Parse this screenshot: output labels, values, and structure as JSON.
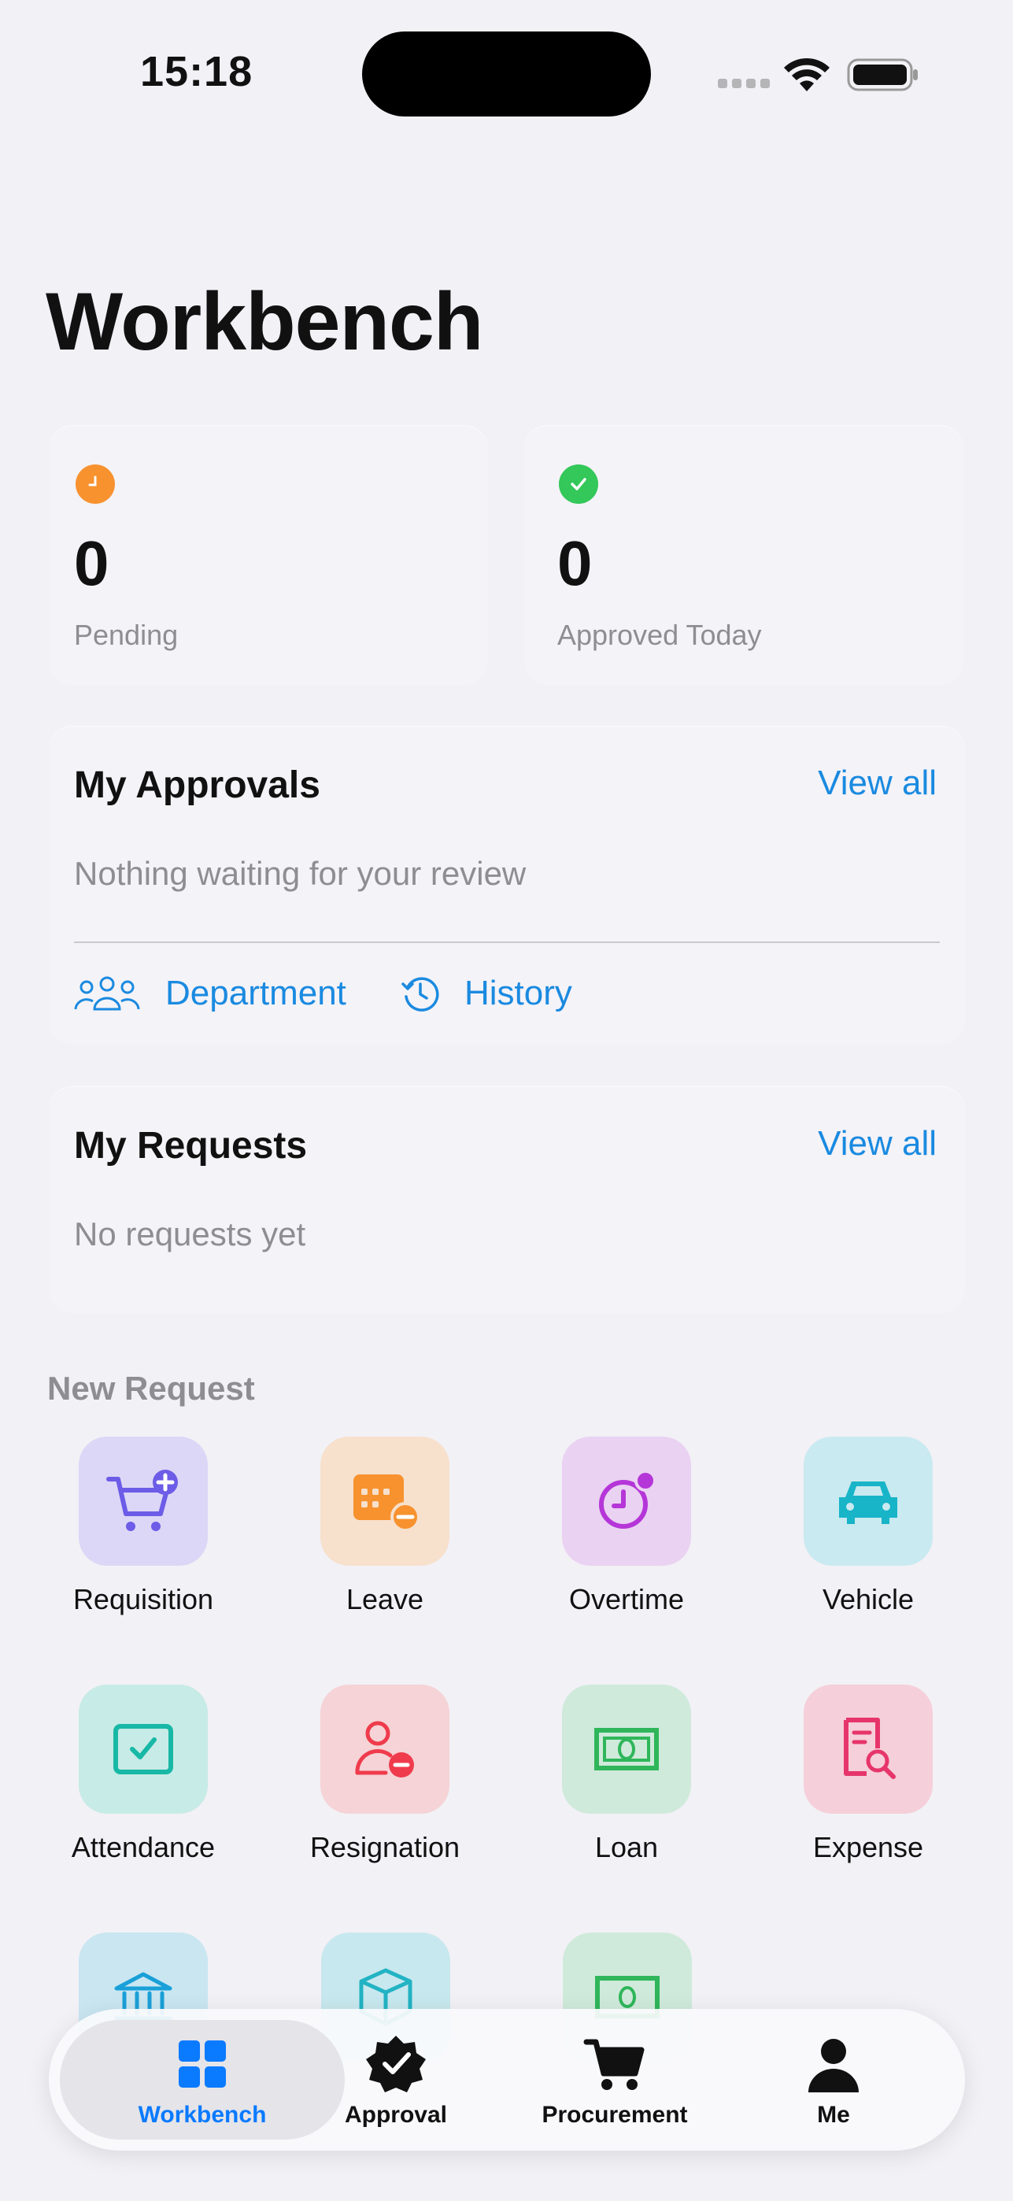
{
  "status_bar": {
    "time": "15:18"
  },
  "page": {
    "title": "Workbench"
  },
  "stats": [
    {
      "value": "0",
      "label": "Pending",
      "color": "#f7922f"
    },
    {
      "value": "0",
      "label": "Approved Today",
      "color": "#34c759"
    }
  ],
  "approvals": {
    "title": "My Approvals",
    "view_all": "View all",
    "empty": "Nothing waiting for your review",
    "department": "Department",
    "history": "History"
  },
  "requests": {
    "title": "My Requests",
    "view_all": "View all",
    "empty": "No requests yet"
  },
  "new_request": {
    "title": "New Request",
    "items": [
      {
        "label": "Requisition",
        "icon": "cart-plus-icon"
      },
      {
        "label": "Leave",
        "icon": "calendar-minus-icon"
      },
      {
        "label": "Overtime",
        "icon": "clock-badge-icon"
      },
      {
        "label": "Vehicle",
        "icon": "car-icon"
      },
      {
        "label": "Attendance",
        "icon": "checkbox-icon"
      },
      {
        "label": "Resignation",
        "icon": "person-minus-icon"
      },
      {
        "label": "Loan",
        "icon": "banknote-icon"
      },
      {
        "label": "Expense",
        "icon": "receipt-search-icon"
      }
    ]
  },
  "tabbar": {
    "tabs": [
      {
        "label": "Workbench",
        "icon": "grid-icon",
        "active": true,
        "color": "#0a7aff"
      },
      {
        "label": "Approval",
        "icon": "seal-check-icon",
        "active": false
      },
      {
        "label": "Procurement",
        "icon": "cart-icon",
        "active": false
      },
      {
        "label": "Me",
        "icon": "person-icon",
        "active": false
      }
    ]
  }
}
